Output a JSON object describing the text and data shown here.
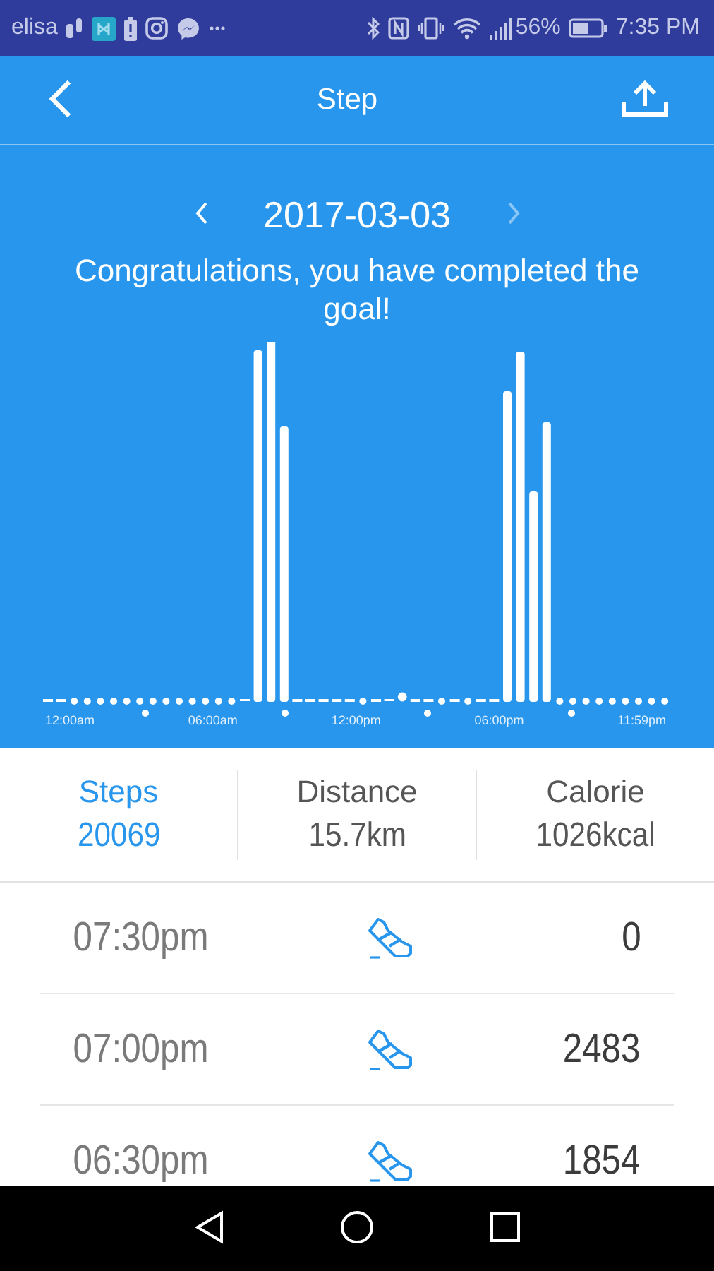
{
  "status_bar": {
    "carrier": "elisa",
    "battery_percent": "56%",
    "time": "7:35 PM"
  },
  "app_bar": {
    "title": "Step"
  },
  "date_nav": {
    "date": "2017-03-03",
    "next_disabled": true
  },
  "message": "Congratulations, you have completed the goal!",
  "chart": {
    "time_labels": [
      "12:00am",
      "06:00am",
      "12:00pm",
      "06:00pm",
      "11:59pm"
    ]
  },
  "stats": [
    {
      "label": "Steps",
      "value": "20069",
      "selected": true
    },
    {
      "label": "Distance",
      "value": "15.7km",
      "selected": false
    },
    {
      "label": "Calorie",
      "value": "1026kcal",
      "selected": false
    }
  ],
  "records": [
    {
      "time": "07:30pm",
      "steps": "0"
    },
    {
      "time": "07:00pm",
      "steps": "2483"
    },
    {
      "time": "06:30pm",
      "steps": "1854"
    }
  ]
}
